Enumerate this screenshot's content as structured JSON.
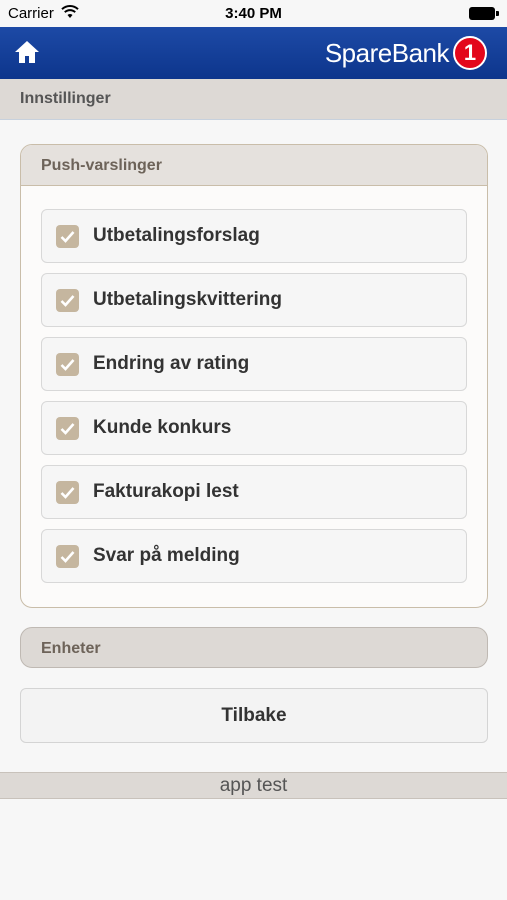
{
  "status_bar": {
    "carrier": "Carrier",
    "time": "3:40 PM"
  },
  "app_bar": {
    "brand_name": "SpareBank",
    "brand_number": "1",
    "home_icon": "home-icon"
  },
  "page": {
    "title": "Innstillinger"
  },
  "push_panel": {
    "title": "Push-varslinger",
    "items": [
      {
        "label": "Utbetalingsforslag",
        "checked": true
      },
      {
        "label": "Utbetalingskvittering",
        "checked": true
      },
      {
        "label": "Endring av rating",
        "checked": true
      },
      {
        "label": "Kunde konkurs",
        "checked": true
      },
      {
        "label": "Fakturakopi lest",
        "checked": true
      },
      {
        "label": "Svar på melding",
        "checked": true
      }
    ]
  },
  "units_panel": {
    "title": "Enheter"
  },
  "back_button": {
    "label": "Tilbake"
  },
  "footer": {
    "text": "app test"
  },
  "colors": {
    "app_bar": "#0d358c",
    "brand_badge": "#e3071b",
    "checkbox": "#c5b69f"
  }
}
